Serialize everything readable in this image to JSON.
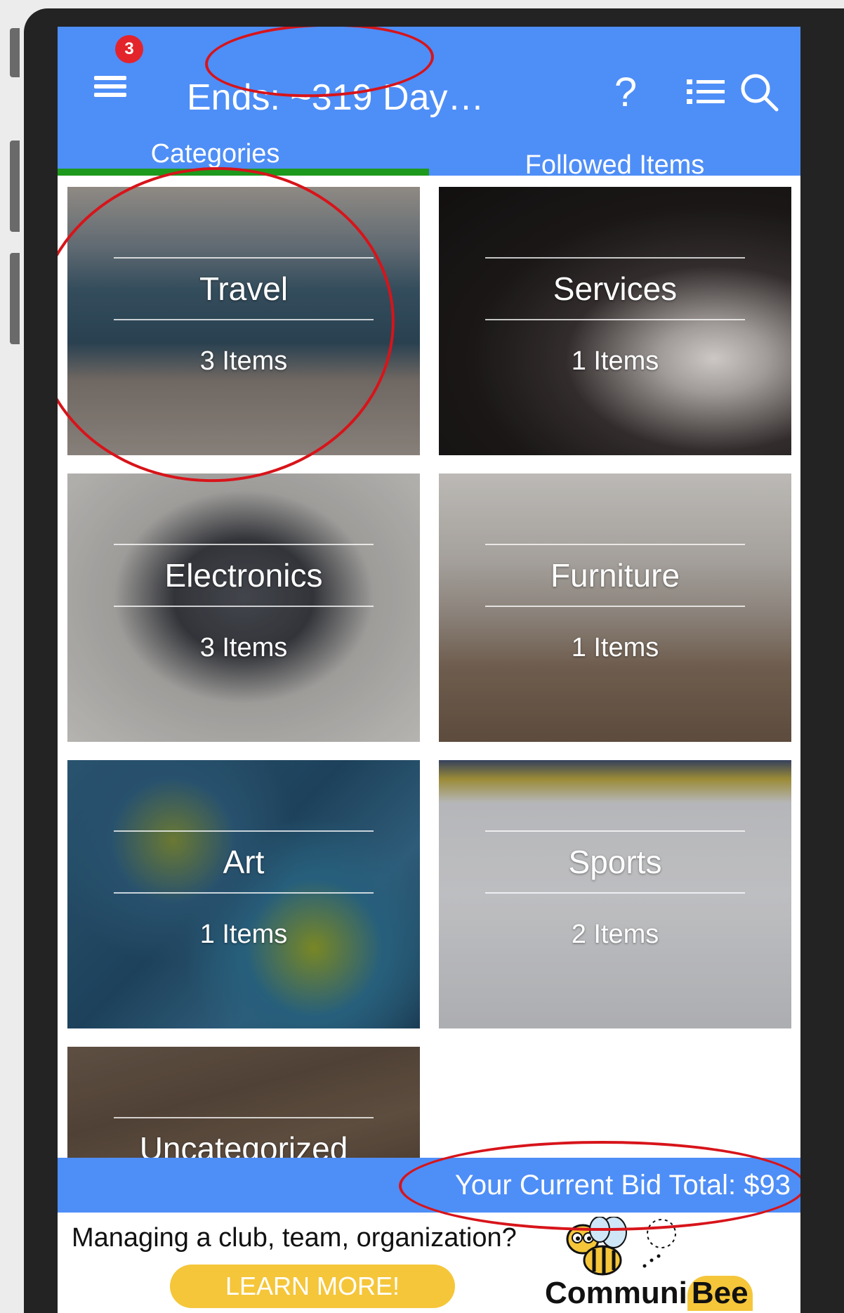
{
  "header": {
    "title": "Ends: ~319 Day…",
    "notification_count": "3",
    "help_symbol": "?",
    "icons": [
      "hamburger-menu-icon",
      "help-icon",
      "list-view-icon",
      "search-icon"
    ]
  },
  "tabs": [
    {
      "label": "Categories",
      "active": true
    },
    {
      "label": "Followed Items",
      "active": false
    }
  ],
  "categories": [
    {
      "name": "Travel",
      "count": "3 Items"
    },
    {
      "name": "Services",
      "count": "1 Items"
    },
    {
      "name": "Electronics",
      "count": "3 Items"
    },
    {
      "name": "Furniture",
      "count": "1 Items"
    },
    {
      "name": "Art",
      "count": "1 Items"
    },
    {
      "name": "Sports",
      "count": "2 Items"
    },
    {
      "name": "Uncategorized",
      "count": ""
    }
  ],
  "bid_bar": {
    "text": "Your Current Bid Total: $93"
  },
  "ad": {
    "headline": "Managing a club, team, organization?",
    "cta": "LEARN MORE!",
    "logo_text_1": "Communi",
    "logo_text_2": "Bee"
  },
  "colors": {
    "primary": "#4e8ef7",
    "tab_indicator": "#1d9a1d",
    "badge": "#e3242b",
    "cta": "#f5c63a",
    "annotation": "#d7141a"
  }
}
